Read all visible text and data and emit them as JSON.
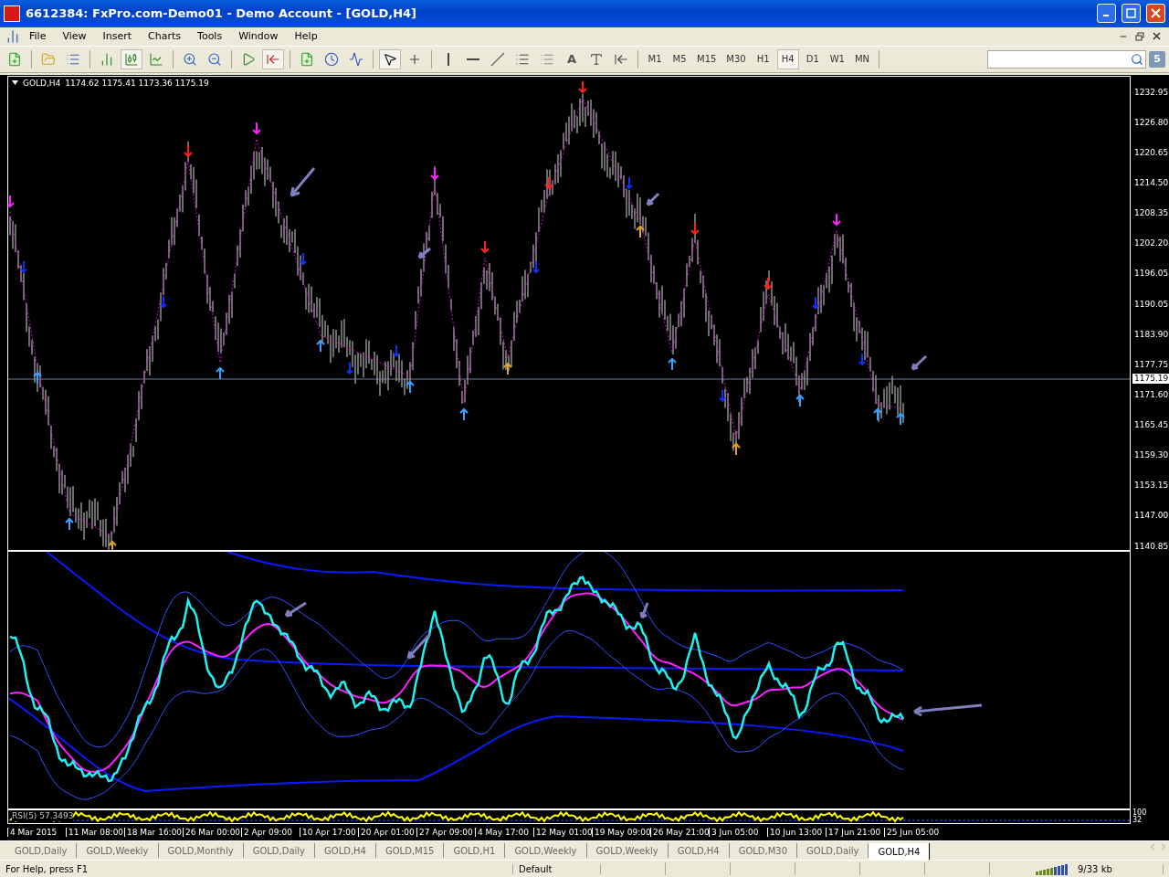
{
  "window": {
    "title": "6612384: FxPro.com-Demo01 - Demo Account - [GOLD,H4]"
  },
  "menu": [
    "File",
    "View",
    "Insert",
    "Charts",
    "Tools",
    "Window",
    "Help"
  ],
  "toolbar": {
    "text_tool": "A",
    "timeframes": [
      {
        "label": "M1",
        "selected": false
      },
      {
        "label": "M5",
        "selected": false
      },
      {
        "label": "M15",
        "selected": false
      },
      {
        "label": "M30",
        "selected": false
      },
      {
        "label": "H1",
        "selected": false
      },
      {
        "label": "H4",
        "selected": true
      },
      {
        "label": "D1",
        "selected": false
      },
      {
        "label": "W1",
        "selected": false
      },
      {
        "label": "MN",
        "selected": false
      }
    ],
    "notifications": "5"
  },
  "chart": {
    "symbol": "GOLD,H4",
    "ohlc": "1174.62 1175.41 1173.36 1175.19",
    "price_axis": [
      "1232.95",
      "1226.80",
      "1220.65",
      "1214.50",
      "1208.35",
      "1202.20",
      "1196.05",
      "1190.05",
      "1183.90",
      "1177.75",
      "1171.60",
      "1165.45",
      "1159.30",
      "1153.15",
      "1147.00",
      "1140.85"
    ],
    "current_price": "1175.19",
    "indicator_label": "RSI(5) 57.3493",
    "rsi_axis": [
      "100",
      "32"
    ],
    "time_axis": [
      "4 Mar 2015",
      "11 Mar 08:00",
      "18 Mar 16:00",
      "26 Mar 00:00",
      "2 Apr 09:00",
      "10 Apr 17:00",
      "20 Apr 01:00",
      "27 Apr 09:00",
      "4 May 17:00",
      "12 May 01:00",
      "19 May 09:00",
      "26 May 21:00",
      "3 Jun 05:00",
      "10 Jun 13:00",
      "17 Jun 21:00",
      "25 Jun 05:00"
    ]
  },
  "tabs": [
    {
      "label": "GOLD,Daily",
      "selected": false
    },
    {
      "label": "GOLD,Weekly",
      "selected": false
    },
    {
      "label": "GOLD,Monthly",
      "selected": false
    },
    {
      "label": "GOLD,Daily",
      "selected": false
    },
    {
      "label": "GOLD,H4",
      "selected": false
    },
    {
      "label": "GOLD,M15",
      "selected": false
    },
    {
      "label": "GOLD,H1",
      "selected": false
    },
    {
      "label": "GOLD,Weekly",
      "selected": false
    },
    {
      "label": "GOLD,Weekly",
      "selected": false
    },
    {
      "label": "GOLD,H4",
      "selected": false
    },
    {
      "label": "GOLD,M30",
      "selected": false
    },
    {
      "label": "GOLD,Daily",
      "selected": false
    },
    {
      "label": "GOLD,H4",
      "selected": true
    }
  ],
  "status_bar": {
    "help": "For Help, press F1",
    "profile": "Default",
    "traffic": "9/33 kb"
  }
}
